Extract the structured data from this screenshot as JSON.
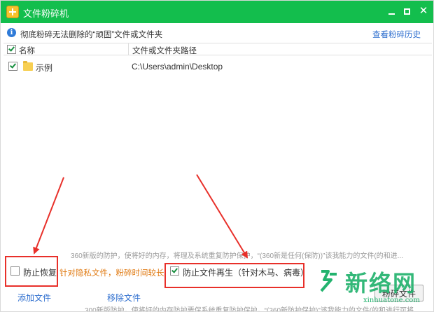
{
  "window": {
    "title": "文件粉碎机",
    "minimize_label": "—",
    "maximize_label": "□",
    "close_label": "✕"
  },
  "infobar": {
    "icon": "info-icon",
    "text": "彻底粉碎无法删除的“顽固”文件或文件夹",
    "history_link": "查看粉碎历史"
  },
  "list": {
    "columns": [
      "名称",
      "文件或文件夹路径"
    ],
    "header_checked": true,
    "rows": [
      {
        "checked": true,
        "icon": "folder-icon",
        "name": "示例",
        "path": "C:\\Users\\admin\\Desktop"
      }
    ]
  },
  "background_text": {
    "line1": "360新版的防护，使将好的内存，将理及系统重复防护保护，“(360新是任何(保防))”该我能力的文件(的和进...",
    "line2": "300新版防护，使将好的内存防护要保系统重复防护保护，“(360新防护保护)”该我能力的文件(的和进行可将"
  },
  "options": {
    "prevent_recovery": {
      "label": "防止恢复",
      "checked": false,
      "note": "针对隐私文件，粉碎时间较长"
    },
    "prevent_regeneration": {
      "label": "防止文件再生（针对木马、病毒）",
      "checked": true
    }
  },
  "actions": {
    "add_file": "添加文件",
    "remove_file": "移除文件",
    "shred_button": "粉碎文件"
  },
  "watermark": {
    "brand_cn": "新络网",
    "brand_en": "xinhuatone.com"
  },
  "colors": {
    "titlebar": "#13be4d",
    "link": "#2f6fcf",
    "note": "#e07a12",
    "annotation": "#e8302a",
    "watermark": "#23b36e"
  }
}
